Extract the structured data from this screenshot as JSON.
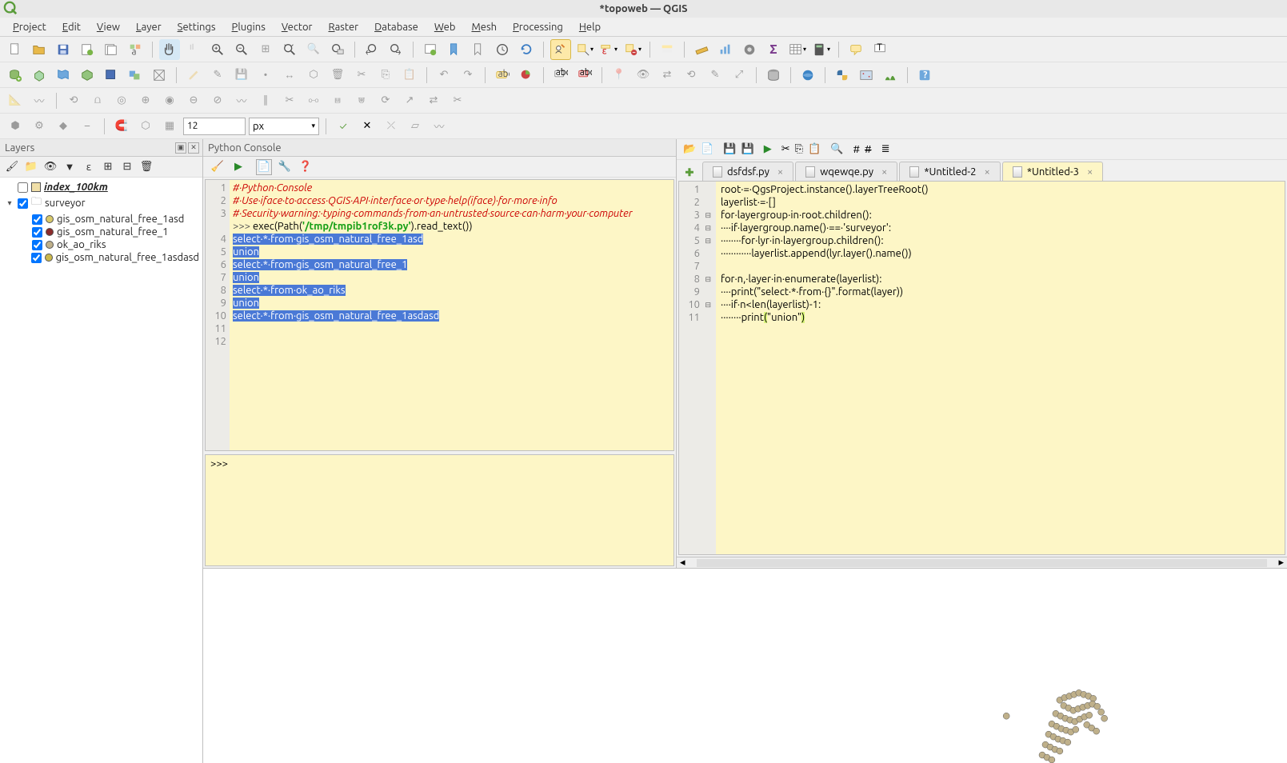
{
  "title": "*topoweb — QGIS",
  "menu": [
    "Project",
    "Edit",
    "View",
    "Layer",
    "Settings",
    "Plugins",
    "Vector",
    "Raster",
    "Database",
    "Web",
    "Mesh",
    "Processing",
    "Help"
  ],
  "toolbar4": {
    "num_value": "12",
    "unit": "px"
  },
  "layers_panel": {
    "title": "Layers",
    "items": [
      {
        "name": "index_100km",
        "checked": false,
        "type": "polygon",
        "bold": true,
        "indent": 0,
        "expander": ""
      },
      {
        "name": "surveyor",
        "checked": true,
        "type": "group",
        "indent": 0,
        "expander": "▾"
      },
      {
        "name": "gis_osm_natural_free_1asd",
        "checked": true,
        "type": "point",
        "color": "#d8c96a",
        "indent": 1
      },
      {
        "name": "gis_osm_natural_free_1",
        "checked": true,
        "type": "point",
        "color": "#8b2b2b",
        "indent": 1
      },
      {
        "name": "ok_ao_riks",
        "checked": true,
        "type": "point",
        "color": "#bfb08a",
        "indent": 1
      },
      {
        "name": "gis_osm_natural_free_1asdasd",
        "checked": true,
        "type": "point",
        "color": "#cbb84b",
        "indent": 1
      }
    ]
  },
  "console": {
    "title": "Python Console",
    "lines": [
      {
        "n": 1,
        "type": "comment",
        "text": "# Python Console"
      },
      {
        "n": 2,
        "type": "comment",
        "text": "# Use iface to access QGIS API interface or type help(iface) for more info"
      },
      {
        "n": 3,
        "type": "comment",
        "text": "# Security warning: typing commands from an untrusted source can harm your computer"
      },
      {
        "n": 4,
        "type": "exec",
        "prompt": ">>> ",
        "code_prefix": "exec(Path(",
        "str": "'/tmp/tmpib1rof3k.py'",
        "code_suffix": ").read_text())"
      },
      {
        "n": 5,
        "type": "sel",
        "text": "select * from gis_osm_natural_free_1asd"
      },
      {
        "n": 6,
        "type": "sel",
        "text": "union"
      },
      {
        "n": 7,
        "type": "sel",
        "text": "select * from gis_osm_natural_free_1"
      },
      {
        "n": 8,
        "type": "sel",
        "text": "union"
      },
      {
        "n": 9,
        "type": "sel",
        "text": "select * from ok_ao_riks"
      },
      {
        "n": 10,
        "type": "sel",
        "text": "union"
      },
      {
        "n": 11,
        "type": "sel",
        "text": "select * from gis_osm_natural_free_1asdasd"
      },
      {
        "n": 12,
        "type": "blank",
        "text": ""
      }
    ],
    "input_prompt": ">>>"
  },
  "editor": {
    "tabs": [
      {
        "label": "dsfdsf.py",
        "active": false
      },
      {
        "label": "wqewqe.py",
        "active": false
      },
      {
        "label": "*Untitled-2",
        "active": false
      },
      {
        "label": "*Untitled-3",
        "active": true
      }
    ],
    "lines": [
      {
        "n": 1,
        "fold": "",
        "tokens": [
          [
            "name",
            "root "
          ],
          [
            "op",
            "="
          ],
          [
            "name",
            " QgsProject"
          ],
          [
            "op",
            "."
          ],
          [
            "name",
            "instance"
          ],
          [
            "op",
            "()."
          ],
          [
            "name",
            "layerTreeRoot"
          ],
          [
            "op",
            "()"
          ]
        ]
      },
      {
        "n": 2,
        "fold": "",
        "tokens": [
          [
            "name",
            "layerlist "
          ],
          [
            "op",
            "="
          ],
          [
            "name",
            " "
          ],
          [
            "op",
            "[]"
          ]
        ]
      },
      {
        "n": 3,
        "fold": "⊟",
        "tokens": [
          [
            "kw",
            "for"
          ],
          [
            "name",
            " layergroup "
          ],
          [
            "kw",
            "in"
          ],
          [
            "name",
            " root"
          ],
          [
            "op",
            "."
          ],
          [
            "name",
            "children"
          ],
          [
            "op",
            "():"
          ]
        ]
      },
      {
        "n": 4,
        "fold": "⊟",
        "tokens": [
          [
            "name",
            "    "
          ],
          [
            "kw",
            "if"
          ],
          [
            "name",
            " layergroup"
          ],
          [
            "op",
            "."
          ],
          [
            "name",
            "name"
          ],
          [
            "op",
            "() == "
          ],
          [
            "str",
            "'surveyor'"
          ],
          [
            "op",
            ":"
          ]
        ]
      },
      {
        "n": 5,
        "fold": "⊟",
        "tokens": [
          [
            "name",
            "        "
          ],
          [
            "kw",
            "for"
          ],
          [
            "name",
            " lyr "
          ],
          [
            "kw",
            "in"
          ],
          [
            "name",
            " layergroup"
          ],
          [
            "op",
            "."
          ],
          [
            "name",
            "children"
          ],
          [
            "op",
            "():"
          ]
        ]
      },
      {
        "n": 6,
        "fold": "",
        "tokens": [
          [
            "name",
            "            layerlist"
          ],
          [
            "op",
            "."
          ],
          [
            "name",
            "append"
          ],
          [
            "op",
            "("
          ],
          [
            "name",
            "lyr"
          ],
          [
            "op",
            "."
          ],
          [
            "name",
            "layer"
          ],
          [
            "op",
            "()."
          ],
          [
            "name",
            "name"
          ],
          [
            "op",
            "())"
          ]
        ]
      },
      {
        "n": 7,
        "fold": "",
        "tokens": []
      },
      {
        "n": 8,
        "fold": "⊟",
        "tokens": [
          [
            "kw",
            "for"
          ],
          [
            "name",
            " n"
          ],
          [
            "op",
            ", "
          ],
          [
            "name",
            "layer "
          ],
          [
            "kw",
            "in"
          ],
          [
            "name",
            " enumerate"
          ],
          [
            "op",
            "("
          ],
          [
            "name",
            "layerlist"
          ],
          [
            "op",
            "):"
          ]
        ]
      },
      {
        "n": 9,
        "fold": "",
        "tokens": [
          [
            "name",
            "    print"
          ],
          [
            "op",
            "("
          ],
          [
            "str",
            "\"select * from {}\""
          ],
          [
            "op",
            "."
          ],
          [
            "name",
            "format"
          ],
          [
            "op",
            "("
          ],
          [
            "name",
            "layer"
          ],
          [
            "op",
            "))"
          ]
        ]
      },
      {
        "n": 10,
        "fold": "⊟",
        "tokens": [
          [
            "name",
            "    "
          ],
          [
            "kw",
            "if"
          ],
          [
            "name",
            " n"
          ],
          [
            "op",
            "<"
          ],
          [
            "name",
            "len"
          ],
          [
            "op",
            "("
          ],
          [
            "name",
            "layerlist"
          ],
          [
            "op",
            ")-"
          ],
          [
            "num",
            "1"
          ],
          [
            "op",
            ":"
          ]
        ]
      },
      {
        "n": 11,
        "fold": "",
        "tokens": [
          [
            "name",
            "        print"
          ],
          [
            "hl",
            "("
          ],
          [
            "str",
            "\"union\""
          ],
          [
            "hl",
            ")"
          ]
        ]
      }
    ]
  }
}
